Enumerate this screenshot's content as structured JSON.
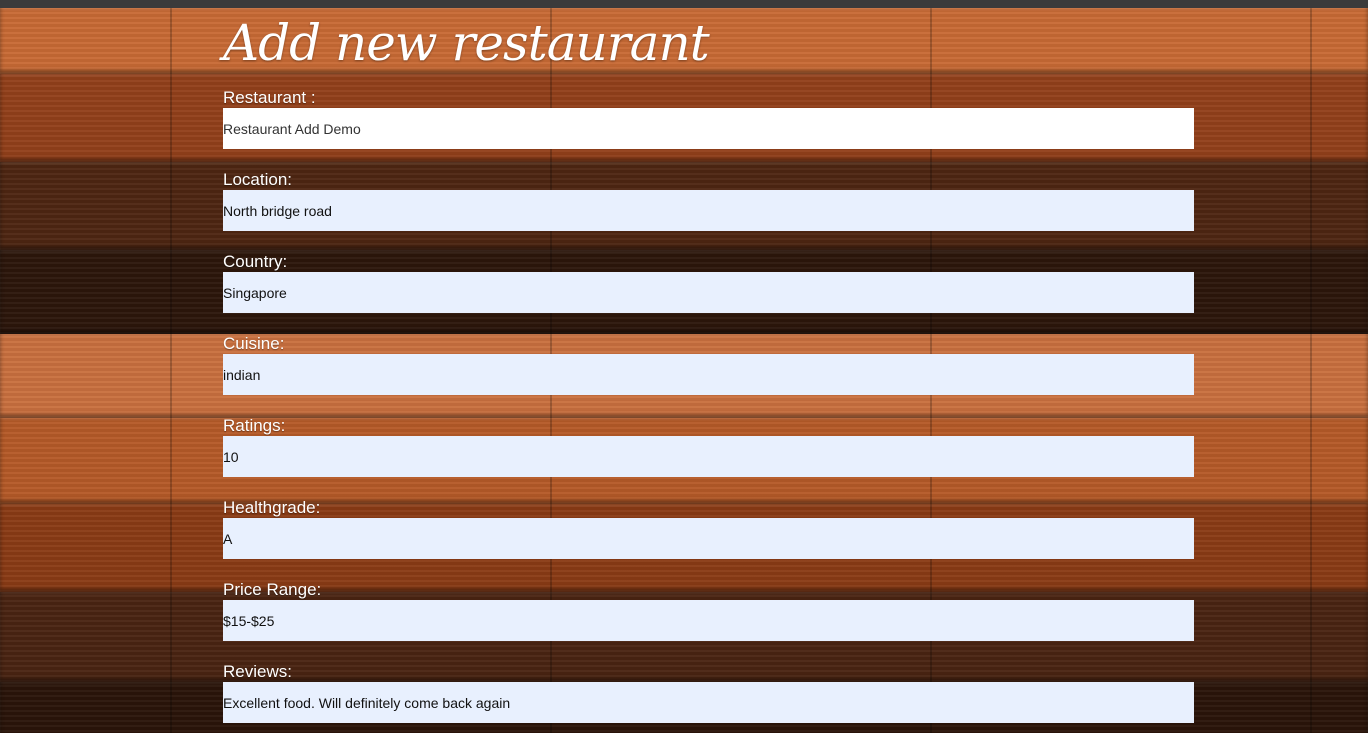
{
  "page": {
    "title": "Add new restaurant"
  },
  "form": {
    "fields": [
      {
        "label": "Restaurant :",
        "value": "Restaurant Add Demo"
      },
      {
        "label": "Location:",
        "value": "North bridge road"
      },
      {
        "label": "Country:",
        "value": "Singapore"
      },
      {
        "label": "Cuisine:",
        "value": "indian"
      },
      {
        "label": "Ratings:",
        "value": "10"
      },
      {
        "label": "Healthgrade:",
        "value": "A"
      },
      {
        "label": "Price Range:",
        "value": "$15-$25"
      },
      {
        "label": "Reviews:",
        "value": "Excellent food. Will definitely come back again"
      }
    ]
  },
  "colors": {
    "autofill_background": "#e8f0fe",
    "text_on_wood": "#ffffff",
    "top_bar": "#3b3b3b"
  }
}
